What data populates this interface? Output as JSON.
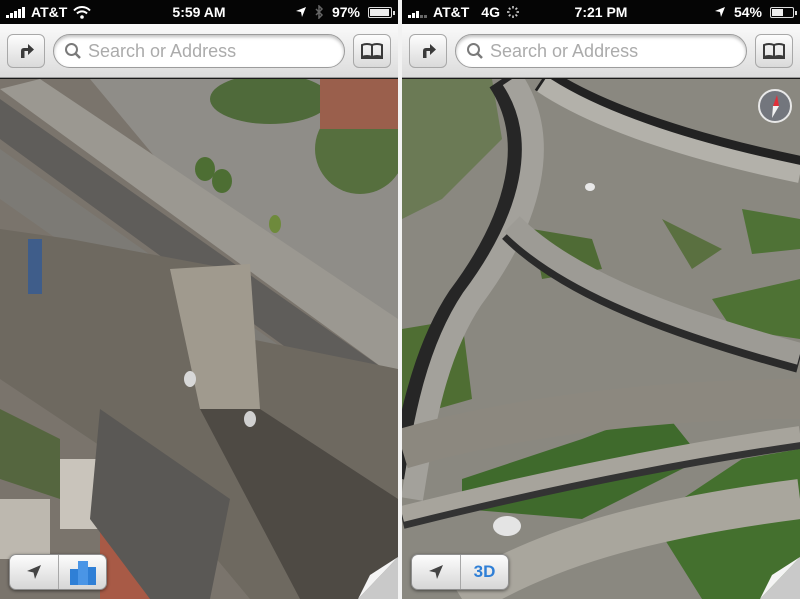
{
  "screens": [
    {
      "status": {
        "carrier": "AT&T",
        "network": "",
        "time": "5:59 AM",
        "battery": "97%",
        "battery_level": 0.97,
        "wifi": true,
        "bluetooth": true,
        "location": true,
        "signal_bars": 5
      },
      "search": {
        "placeholder": "Search or Address",
        "value": ""
      },
      "buttons": {
        "directions": "directions-icon",
        "bookmarks": "bookmarks-icon"
      },
      "controls": {
        "locate": "location-arrow-icon",
        "mode": "3d-buildings-icon"
      },
      "compass": false
    },
    {
      "status": {
        "carrier": "AT&T",
        "network": "4G",
        "time": "7:21 PM",
        "battery": "54%",
        "battery_level": 0.54,
        "wifi": false,
        "bluetooth": false,
        "location": true,
        "signal_bars": 3
      },
      "search": {
        "placeholder": "Search or Address",
        "value": ""
      },
      "buttons": {
        "directions": "directions-icon",
        "bookmarks": "bookmarks-icon"
      },
      "controls": {
        "locate": "location-arrow-icon",
        "mode_label": "3D"
      },
      "compass": true
    }
  ],
  "colors": {
    "accent": "#2f7fd6",
    "compass_red": "#e0303a"
  }
}
